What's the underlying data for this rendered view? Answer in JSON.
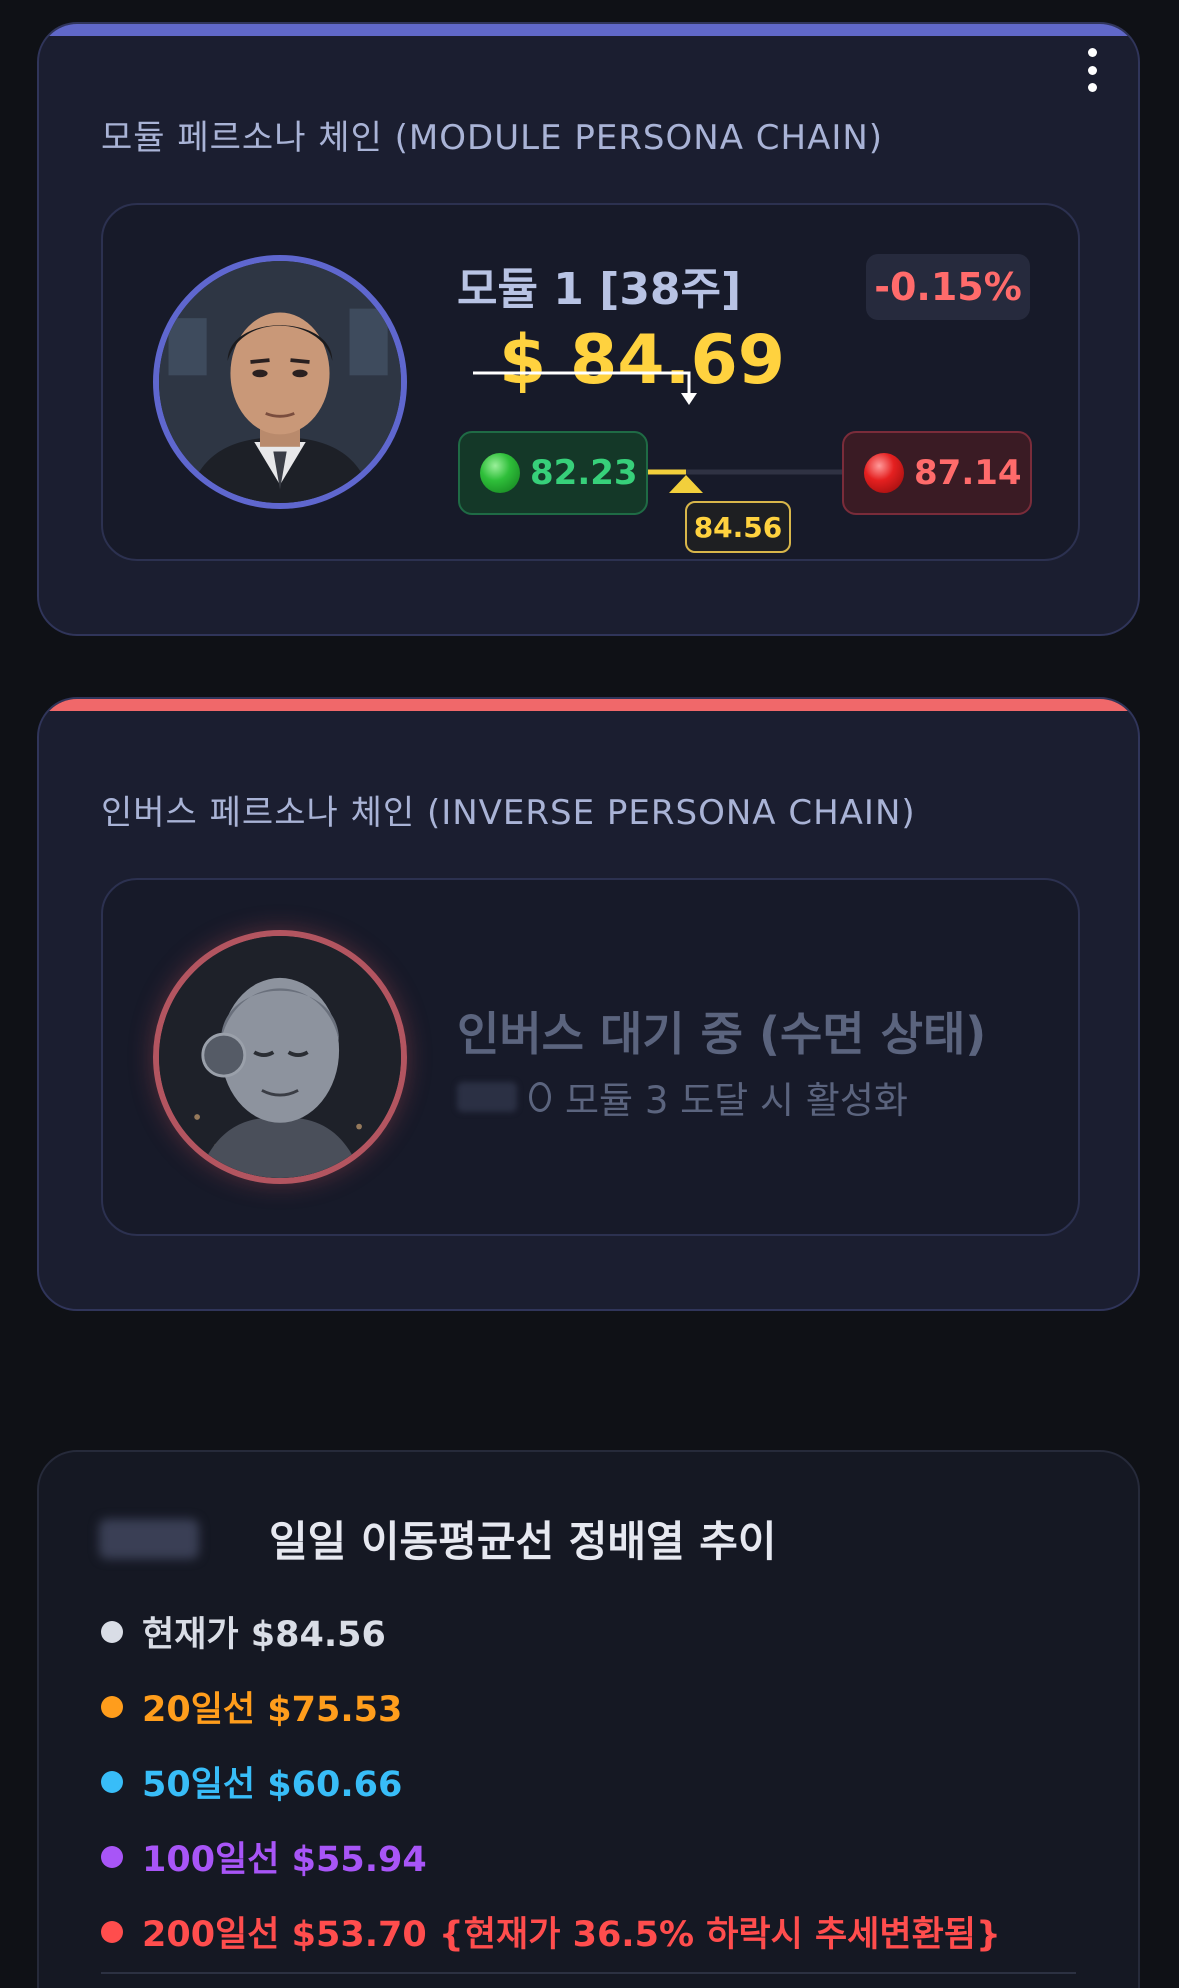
{
  "module_card": {
    "title": "모듈 페르소나 체인 (MODULE PERSONA CHAIN)",
    "module_name": "모듈 1 [38주]",
    "change": "-0.15%",
    "price": "$ 84.69",
    "low": "82.23",
    "high": "87.14",
    "marker_value": "84.56",
    "marker_level": 0.47,
    "colors": {
      "accent": "#6068c8",
      "price": "#ffd23f",
      "down": "#ff6b6b",
      "up": "#37d07a"
    }
  },
  "inverse_card": {
    "title": "인버스 페르소나 체인 (INVERSE PERSONA CHAIN)",
    "status": "인버스 대기 중 (수면 상태)",
    "sub": "모듈 3 도달 시 활성화",
    "colors": {
      "accent": "#f0686a"
    }
  },
  "ma_card": {
    "title": "일일 이동평균선 정배열 추이",
    "items": [
      {
        "label": "현재가 $84.56",
        "color": "#d9dde6"
      },
      {
        "label": "20일선 $75.53",
        "color": "#ff9d1c"
      },
      {
        "label": "50일선 $60.66",
        "color": "#38bdf8"
      },
      {
        "label": "100일선 $55.94",
        "color": "#a855f7"
      },
      {
        "label": "200일선 $53.70 {현재가 36.5% 하락시 추세변환됨}",
        "color": "#ff4d4d"
      }
    ]
  }
}
